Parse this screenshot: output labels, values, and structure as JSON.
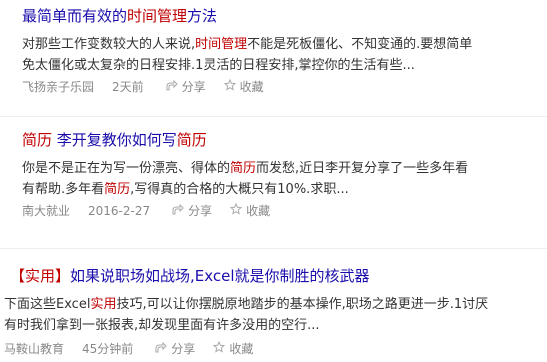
{
  "results": [
    {
      "title_pre": "最简单而有效的",
      "title_hl": "时间管理",
      "title_post": "方法",
      "abstract_line1_a": "对那些工作变数较大的人来说,",
      "abstract_line1_hl": "时间管理",
      "abstract_line1_b": "不能是死板僵化、不知变通的.要想简单",
      "abstract_line2": "免太僵化或太复杂的日程安排.1灵活的日程安排,掌控你的生活有些...",
      "source": "飞扬亲子乐园",
      "time": "2天前",
      "share_label": "分享",
      "collect_label": "收藏"
    },
    {
      "title_hl": "简历",
      "title_mid": " 李开复教你如何写",
      "title_hl2": "简历",
      "abstract_line1_a": "你是不是正在为写一份漂亮、得体的",
      "abstract_line1_hl": "简历",
      "abstract_line1_b": "而发愁,近日李开复分享了一些多年看",
      "abstract_line2_a": "有帮助.多年看",
      "abstract_line2_hl": "简历",
      "abstract_line2_b": ",写得真的合格的大概只有10%.求职...",
      "source": "南大就业",
      "time": "2016-2-27",
      "share_label": "分享",
      "collect_label": "收藏"
    },
    {
      "tag": "【实用】",
      "title_text": "如果说职场如战场,Excel就是你制胜的核武器",
      "abstract_line1_a": "下面这些Excel",
      "abstract_line1_hl": "实用",
      "abstract_line1_b": "技巧,可以让你摆脱原地踏步的基本操作,职场之路更进一步.1讨厌",
      "abstract_line2": "有时我们拿到一张报表,却发现里面有许多没用的空行...",
      "source": "马鞍山教育",
      "time": "45分钟前",
      "share_label": "分享",
      "collect_label": "收藏"
    }
  ],
  "colors": {
    "title": "#1a0dab",
    "highlight": "#c00000",
    "meta": "#888888"
  },
  "icons": {
    "share": "share-icon",
    "collect": "star-icon"
  }
}
